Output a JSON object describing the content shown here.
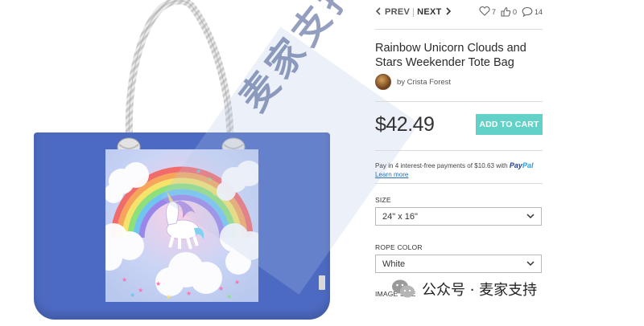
{
  "nav": {
    "prev_label": "PREV",
    "next_label": "NEXT",
    "favorites_count": "7",
    "likes_count": "0",
    "comments_count": "14"
  },
  "product": {
    "title": "Rainbow Unicorn Clouds and Stars Weekender Tote Bag",
    "creator": "by Crista Forest",
    "price": "$42.49",
    "add_to_cart_label": "ADD TO CART"
  },
  "paypal": {
    "text": "Pay in 4 interest-free payments of $10.63 with",
    "logo_pay": "Pay",
    "logo_pal": "Pal",
    "learn_more": "Learn more"
  },
  "options": {
    "size_label": "SIZE",
    "size_value": "24\" x 16\"",
    "rope_color_label": "ROPE COLOR",
    "rope_color_value": "White",
    "image_size_label": "IMAGE SIZE"
  },
  "watermark": {
    "diagonal_text": "麦家支持",
    "channel_text": "公众号 · 麦家支持"
  },
  "colors": {
    "bag_blue": "#4d6ac2",
    "cart_teal": "#62d2c8",
    "paypal_dark": "#1f3f8f",
    "paypal_light": "#2a9be0"
  }
}
